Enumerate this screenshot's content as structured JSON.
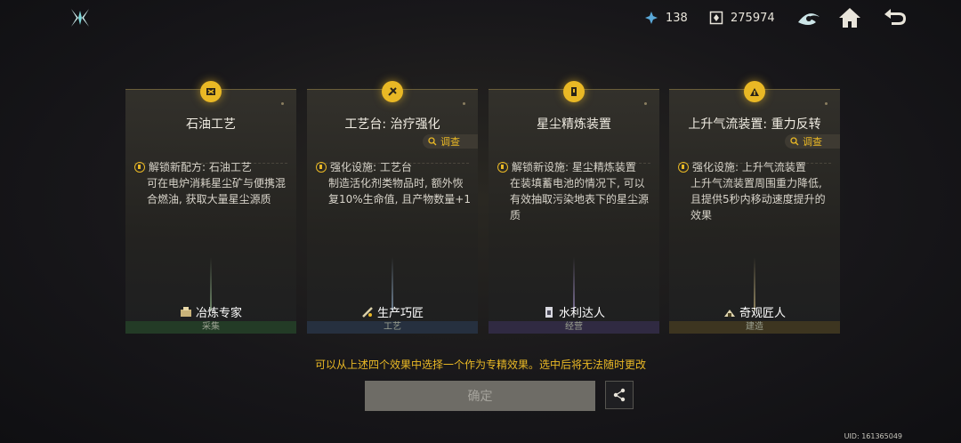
{
  "header": {
    "logo_icon": "logo-icon",
    "resources": [
      {
        "name": "star-dust",
        "icon": "star-dust-icon",
        "value": "138"
      },
      {
        "name": "currency",
        "icon": "currency-icon",
        "value": "275974"
      }
    ],
    "actions": [
      {
        "name": "map-button",
        "icon": "map-icon"
      },
      {
        "name": "home-button",
        "icon": "home-icon"
      },
      {
        "name": "back-button",
        "icon": "back-icon"
      }
    ]
  },
  "cards": [
    {
      "title": "石油工艺",
      "inspect": "",
      "desc_head": "解锁新配方: 石油工艺",
      "desc_body": "可在电炉消耗星尘矿与便携混合燃油, 获取大量星尘源质",
      "skill": "冶炼专家",
      "category": "采集",
      "cat_color": "#234a2a"
    },
    {
      "title": "工艺台: 治疗强化",
      "inspect": "调查",
      "desc_head": "强化设施: 工艺台",
      "desc_body": "制造活化剂类物品时, 额外恢复10%生命值, 且产物数量+1",
      "skill": "生产巧匠",
      "category": "工艺",
      "cat_color": "#28344a"
    },
    {
      "title": "星尘精炼装置",
      "inspect": "",
      "desc_head": "解锁新设施: 星尘精炼装置",
      "desc_body": "在装填蓄电池的情况下, 可以有效抽取污染地表下的星尘源质",
      "skill": "水利达人",
      "category": "经营",
      "cat_color": "#342a48"
    },
    {
      "title": "上升气流装置: 重力反转",
      "inspect": "调查",
      "desc_head": "强化设施: 上升气流装置",
      "desc_body": "上升气流装置周围重力降低, 且提供5秒内移动速度提升的效果",
      "skill": "奇观匠人",
      "category": "建造",
      "cat_color": "#4a4020"
    }
  ],
  "footer": {
    "hint": "可以从上述四个效果中选择一个作为专精效果。选中后将无法随时更改",
    "confirm_label": "确定",
    "share_icon": "share-icon",
    "uid": "UID: 161365049"
  },
  "colors": {
    "accent": "#e9b825"
  }
}
